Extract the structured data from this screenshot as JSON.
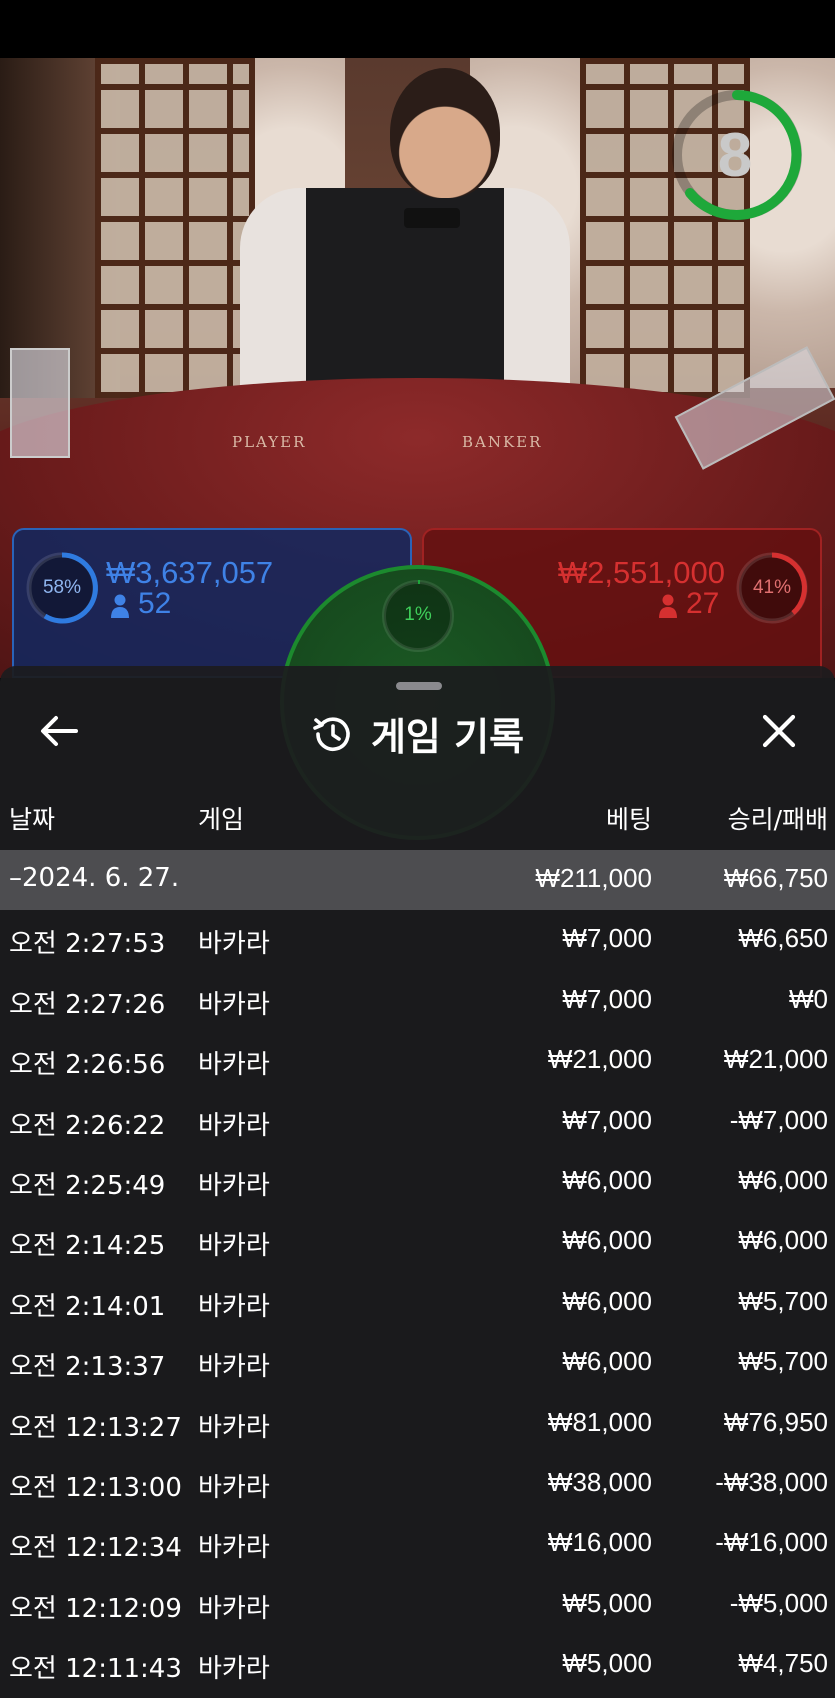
{
  "game": {
    "timer": "8",
    "table_labels": {
      "player": "PLAYER",
      "banker": "BANKER"
    },
    "player": {
      "percent": "58%",
      "amount": "₩3,637,057",
      "count": "52"
    },
    "banker": {
      "percent": "41%",
      "amount": "₩2,551,000",
      "count": "27"
    },
    "tie": {
      "percent": "1%"
    }
  },
  "colors": {
    "player": "#2a63b8",
    "banker": "#c42a2a",
    "tie": "#1c9a33",
    "sheet_bg": "#1c1c1e",
    "group_row": "#77777b"
  },
  "sheet": {
    "title": "게임 기록",
    "icons": {
      "back": "arrow-left-icon",
      "history": "history-icon",
      "close": "close-icon"
    },
    "headers": {
      "date": "날짜",
      "game": "게임",
      "bet": "베팅",
      "win_loss": "승리/패배"
    },
    "group": {
      "date": "–2024. 6. 27.",
      "bet": "₩211,000",
      "win_loss": "₩66,750"
    },
    "rows": [
      {
        "time": "오전 2:27:53",
        "game": "바카라",
        "bet": "₩7,000",
        "win_loss": "₩6,650"
      },
      {
        "time": "오전 2:27:26",
        "game": "바카라",
        "bet": "₩7,000",
        "win_loss": "₩0"
      },
      {
        "time": "오전 2:26:56",
        "game": "바카라",
        "bet": "₩21,000",
        "win_loss": "₩21,000"
      },
      {
        "time": "오전 2:26:22",
        "game": "바카라",
        "bet": "₩7,000",
        "win_loss": "-₩7,000"
      },
      {
        "time": "오전 2:25:49",
        "game": "바카라",
        "bet": "₩6,000",
        "win_loss": "₩6,000"
      },
      {
        "time": "오전 2:14:25",
        "game": "바카라",
        "bet": "₩6,000",
        "win_loss": "₩6,000"
      },
      {
        "time": "오전 2:14:01",
        "game": "바카라",
        "bet": "₩6,000",
        "win_loss": "₩5,700"
      },
      {
        "time": "오전 2:13:37",
        "game": "바카라",
        "bet": "₩6,000",
        "win_loss": "₩5,700"
      },
      {
        "time": "오전 12:13:27",
        "game": "바카라",
        "bet": "₩81,000",
        "win_loss": "₩76,950"
      },
      {
        "time": "오전 12:13:00",
        "game": "바카라",
        "bet": "₩38,000",
        "win_loss": "-₩38,000"
      },
      {
        "time": "오전 12:12:34",
        "game": "바카라",
        "bet": "₩16,000",
        "win_loss": "-₩16,000"
      },
      {
        "time": "오전 12:12:09",
        "game": "바카라",
        "bet": "₩5,000",
        "win_loss": "-₩5,000"
      },
      {
        "time": "오전 12:11:43",
        "game": "바카라",
        "bet": "₩5,000",
        "win_loss": "₩4,750"
      }
    ]
  }
}
